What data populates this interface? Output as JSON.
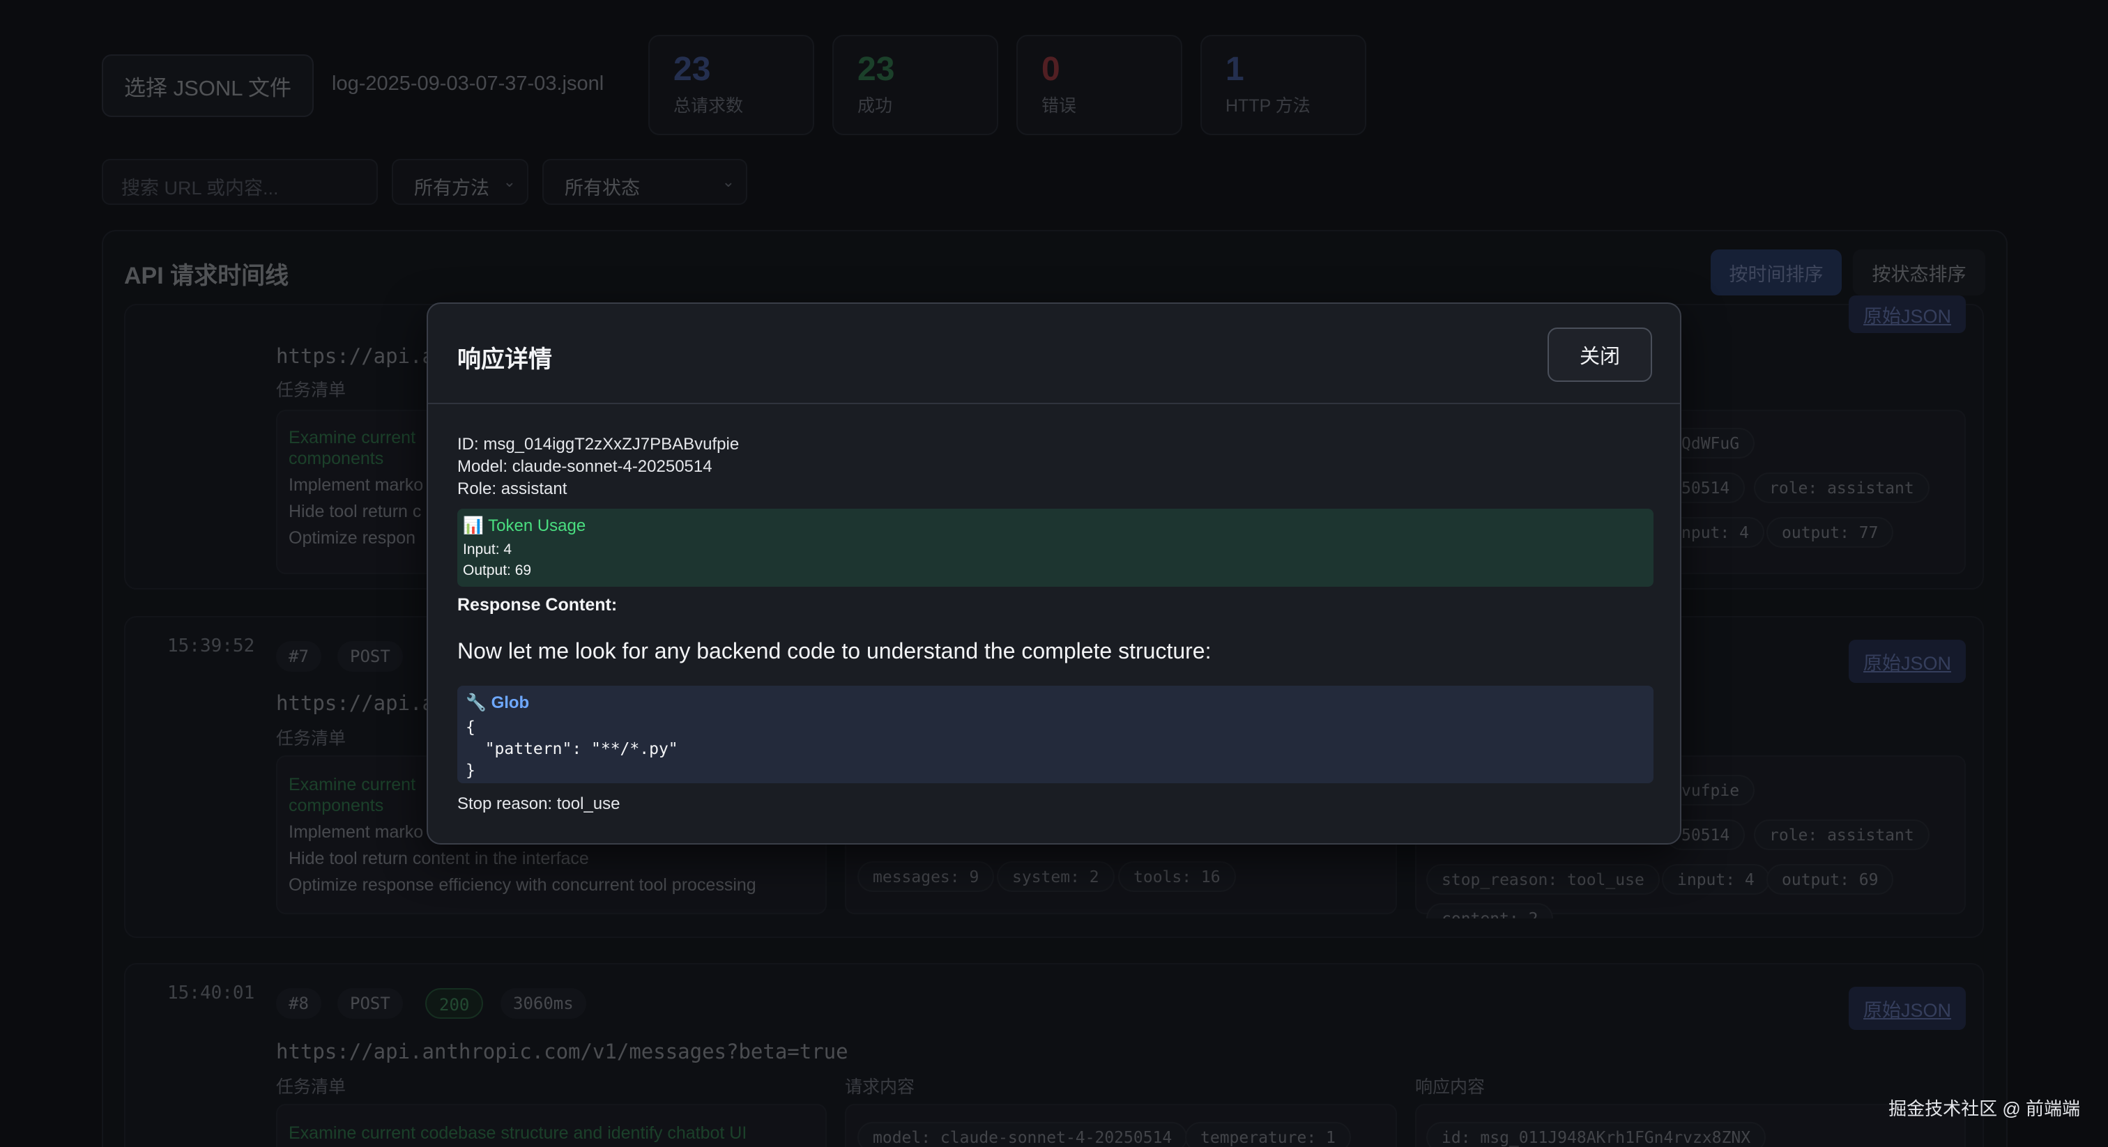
{
  "header": {
    "file_button": "选择 JSONL 文件",
    "file_name": "log-2025-09-03-07-37-03.jsonl"
  },
  "stats": [
    {
      "value": "23",
      "label": "总请求数",
      "color": "#5b7bd5"
    },
    {
      "value": "23",
      "label": "成功",
      "color": "#3fae63"
    },
    {
      "value": "0",
      "label": "错误",
      "color": "#e5484d"
    },
    {
      "value": "1",
      "label": "HTTP 方法",
      "color": "#5b7bd5"
    }
  ],
  "filters": {
    "search_placeholder": "搜索 URL 或内容...",
    "method_select": "所有方法",
    "status_select": "所有状态"
  },
  "timeline": {
    "title": "API 请求时间线",
    "sort_time": "按时间排序",
    "sort_status": "按状态排序"
  },
  "cards": {
    "prev": {
      "url": "https://api.a",
      "tasks_label": "任务清单",
      "tasks": [
        "Examine current",
        "components",
        "Implement marko",
        "Hide tool return c",
        "Optimize respon"
      ],
      "resp_tags": [
        "QdWFuG",
        "50514",
        "role: assistant",
        "nput: 4",
        "output: 77"
      ],
      "json_button": "原始JSON"
    },
    "c7": {
      "time": "15:39:52",
      "id": "#7",
      "method": "POST",
      "url": "https://api.a",
      "tasks_label": "任务清单",
      "tasks": [
        "Examine current",
        "components",
        "Implement marko",
        "Hide tool return content in the interface",
        "Optimize response efficiency with concurrent tool processing"
      ],
      "req_tags": [
        "messages: 9",
        "system: 2",
        "tools: 16"
      ],
      "resp_tags": [
        "vufpie",
        "50514",
        "role: assistant",
        "stop_reason: tool_use",
        "input: 4",
        "output: 69",
        "content: 2"
      ],
      "json_button": "原始JSON"
    },
    "c8": {
      "time": "15:40:01",
      "id": "#8",
      "method": "POST",
      "status": "200",
      "duration": "3060ms",
      "url": "https://api.anthropic.com/v1/messages?beta=true",
      "tasks_label": "任务清单",
      "req_label": "请求内容",
      "resp_label": "响应内容",
      "task_first": "Examine current codebase structure and identify chatbot UI",
      "req_tags": [
        "model: claude-sonnet-4-20250514",
        "temperature: 1"
      ],
      "resp_tag": "id: msg_011J948AKrh1FGn4rvzx8ZNX",
      "json_button": "原始JSON"
    }
  },
  "watermark": "掘金技术社区 @ 前端端",
  "modal": {
    "title": "响应详情",
    "close": "关闭",
    "id": "ID: msg_014iggT2zXxZJ7PBABvufpie",
    "model": "Model: claude-sonnet-4-20250514",
    "role": "Role: assistant",
    "usage_icon": "📊",
    "usage_title": "Token Usage",
    "usage_input": "Input: 4",
    "usage_output": "Output: 69",
    "content_label": "Response Content:",
    "content_text": "Now let me look for any backend code to understand the complete structure:",
    "tool_icon": "🔧",
    "tool_name": "Glob",
    "tool_json": "{\n  \"pattern\": \"**/*.py\"\n}",
    "stop_reason": "Stop reason: tool_use"
  }
}
